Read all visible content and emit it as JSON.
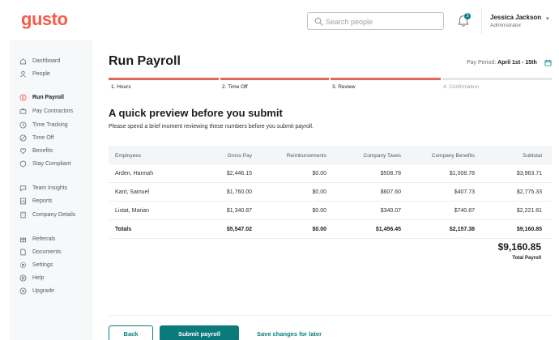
{
  "brand": {
    "logo_text": "gusto",
    "logo_color": "#f45d48",
    "accent_color": "#0a8080"
  },
  "header": {
    "search_placeholder": "Search people",
    "notification_count": "3",
    "user_name": "Jessica Jackson",
    "user_role": "Administrator"
  },
  "sidebar": {
    "items": [
      {
        "label": "Dashboard",
        "icon": "home-icon",
        "active": false
      },
      {
        "label": "People",
        "icon": "person-icon",
        "active": false
      },
      {
        "label": "Run Payroll",
        "icon": "dollar-icon",
        "active": true
      },
      {
        "label": "Pay Contractors",
        "icon": "contractor-icon",
        "active": false
      },
      {
        "label": "Time Tracking",
        "icon": "clock-icon",
        "active": false
      },
      {
        "label": "Time Off",
        "icon": "time-off-icon",
        "active": false
      },
      {
        "label": "Benefits",
        "icon": "heart-icon",
        "active": false
      },
      {
        "label": "Stay Compliant",
        "icon": "shield-icon",
        "active": false
      },
      {
        "label": "Team Insights",
        "icon": "chat-icon",
        "active": false
      },
      {
        "label": "Reports",
        "icon": "report-icon",
        "active": false
      },
      {
        "label": "Company Details",
        "icon": "building-icon",
        "active": false
      },
      {
        "label": "Referrals",
        "icon": "gift-icon",
        "active": false
      },
      {
        "label": "Documents",
        "icon": "document-icon",
        "active": false
      },
      {
        "label": "Settings",
        "icon": "gear-icon",
        "active": false
      },
      {
        "label": "Help",
        "icon": "help-icon",
        "active": false
      },
      {
        "label": "Upgrade",
        "icon": "upgrade-icon",
        "active": false
      }
    ]
  },
  "main": {
    "title": "Run Payroll",
    "pay_period_label": "Pay Period:",
    "pay_period_value": "April 1st - 15th",
    "steps": [
      {
        "label": "1. Hours",
        "complete": true
      },
      {
        "label": "2. Time Off",
        "complete": true
      },
      {
        "label": "3. Review",
        "complete": true
      },
      {
        "label": "4. Confirmation",
        "complete": false
      }
    ],
    "step_complete_color": "#e0665c",
    "step_incomplete_color": "#e4e6e8",
    "subtitle": "A quick preview before you submit",
    "description": "Please spend a brief moment reviewing these numbers before you submit payroll."
  },
  "table": {
    "headers": [
      "Employees",
      "Gross Pay",
      "Reimbursements",
      "Company Taxes",
      "Company Benefits",
      "Subtotal"
    ],
    "rows": [
      [
        "Arden, Hannah",
        "$2,446.15",
        "$0.00",
        "$508.78",
        "$1,008.78",
        "$3,963.71"
      ],
      [
        "Kant, Samuel",
        "$1,760.00",
        "$0.00",
        "$607.60",
        "$407.73",
        "$2,775.33"
      ],
      [
        "Listat, Marian",
        "$1,340.87",
        "$0.00",
        "$340.07",
        "$740.87",
        "$2,221.81"
      ]
    ],
    "totals": [
      "Totals",
      "$5,547.02",
      "$0.00",
      "$1,456.45",
      "$2,157.38",
      "$9,160.85"
    ]
  },
  "summary": {
    "total_value": "$9,160.85",
    "total_label": "Total Payroll"
  },
  "actions": {
    "back_label": "Back",
    "submit_label": "Submit payroll",
    "save_label": "Save changes for later"
  }
}
